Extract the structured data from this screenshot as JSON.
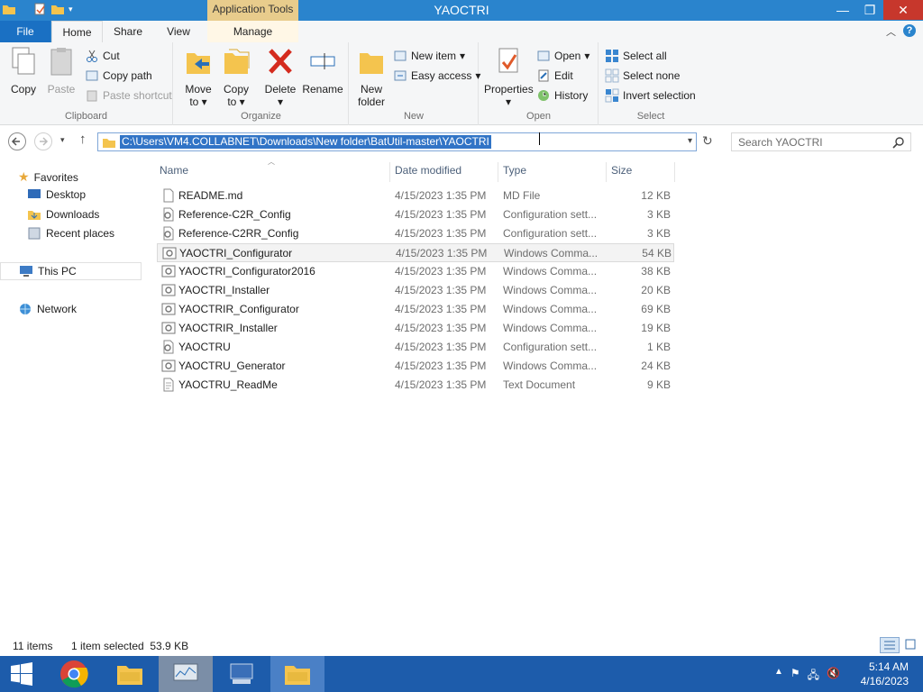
{
  "window": {
    "title": "YAOCTRI",
    "app_tools_tab": "Application Tools",
    "min": "—",
    "max": "❐",
    "close": "✕"
  },
  "tabs": {
    "file": "File",
    "home": "Home",
    "share": "Share",
    "view": "View",
    "manage": "Manage"
  },
  "ribbon": {
    "clipboard": {
      "label": "Clipboard",
      "copy": "Copy",
      "paste": "Paste",
      "cut": "Cut",
      "copy_path": "Copy path",
      "paste_shortcut": "Paste shortcut"
    },
    "organize": {
      "label": "Organize",
      "move_to_1": "Move",
      "move_to_2": "to",
      "copy_to_1": "Copy",
      "copy_to_2": "to",
      "delete": "Delete",
      "rename": "Rename"
    },
    "new": {
      "label": "New",
      "new_folder_1": "New",
      "new_folder_2": "folder",
      "new_item": "New item",
      "easy_access": "Easy access"
    },
    "open": {
      "label": "Open",
      "properties": "Properties",
      "open": "Open",
      "edit": "Edit",
      "history": "History"
    },
    "select": {
      "label": "Select",
      "select_all": "Select all",
      "select_none": "Select none",
      "invert_selection": "Invert selection"
    }
  },
  "address": {
    "path": "C:\\Users\\VM4.COLLABNET\\Downloads\\New folder\\BatUtil-master\\YAOCTRI",
    "search_placeholder": "Search YAOCTRI"
  },
  "navpane": {
    "favorites": "Favorites",
    "desktop": "Desktop",
    "downloads": "Downloads",
    "recent_places": "Recent places",
    "this_pc": "This PC",
    "network": "Network"
  },
  "columns": {
    "name": "Name",
    "date": "Date modified",
    "type": "Type",
    "size": "Size"
  },
  "files": [
    {
      "name": "README.md",
      "date": "4/15/2023 1:35 PM",
      "type": "MD File",
      "size": "12 KB",
      "icon": "document-icon"
    },
    {
      "name": "Reference-C2R_Config",
      "date": "4/15/2023 1:35 PM",
      "type": "Configuration sett...",
      "size": "3 KB",
      "icon": "config-icon"
    },
    {
      "name": "Reference-C2RR_Config",
      "date": "4/15/2023 1:35 PM",
      "type": "Configuration sett...",
      "size": "3 KB",
      "icon": "config-icon"
    },
    {
      "name": "YAOCTRI_Configurator",
      "date": "4/15/2023 1:35 PM",
      "type": "Windows Comma...",
      "size": "54 KB",
      "icon": "batch-icon"
    },
    {
      "name": "YAOCTRI_Configurator2016",
      "date": "4/15/2023 1:35 PM",
      "type": "Windows Comma...",
      "size": "38 KB",
      "icon": "batch-icon"
    },
    {
      "name": "YAOCTRI_Installer",
      "date": "4/15/2023 1:35 PM",
      "type": "Windows Comma...",
      "size": "20 KB",
      "icon": "batch-icon"
    },
    {
      "name": "YAOCTRIR_Configurator",
      "date": "4/15/2023 1:35 PM",
      "type": "Windows Comma...",
      "size": "69 KB",
      "icon": "batch-icon"
    },
    {
      "name": "YAOCTRIR_Installer",
      "date": "4/15/2023 1:35 PM",
      "type": "Windows Comma...",
      "size": "19 KB",
      "icon": "batch-icon"
    },
    {
      "name": "YAOCTRU",
      "date": "4/15/2023 1:35 PM",
      "type": "Configuration sett...",
      "size": "1 KB",
      "icon": "config-icon"
    },
    {
      "name": "YAOCTRU_Generator",
      "date": "4/15/2023 1:35 PM",
      "type": "Windows Comma...",
      "size": "24 KB",
      "icon": "batch-icon"
    },
    {
      "name": "YAOCTRU_ReadMe",
      "date": "4/15/2023 1:35 PM",
      "type": "Text Document",
      "size": "9 KB",
      "icon": "document-icon"
    }
  ],
  "status": {
    "items": "11 items",
    "selected": "1 item selected  53.9 KB"
  },
  "taskbar": {
    "time": "5:14 AM",
    "date": "4/16/2023"
  },
  "colors": {
    "titlebar": "#2a84cd",
    "taskbar": "#1d5cab",
    "selection": "#3174c6"
  }
}
